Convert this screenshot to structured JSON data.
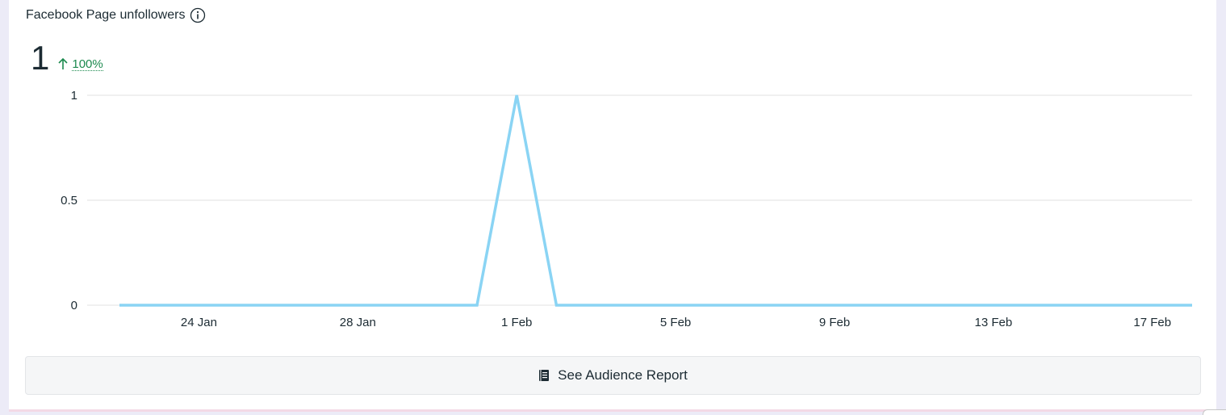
{
  "card": {
    "title": "Facebook Page unfollowers",
    "info_icon": "info-circle-icon",
    "metric_value": "1",
    "delta_icon": "arrow-up-icon",
    "delta_text": "100%",
    "delta_color": "#1d8a4f"
  },
  "chart_data": {
    "type": "line",
    "x": [
      "22 Jan",
      "23 Jan",
      "24 Jan",
      "25 Jan",
      "26 Jan",
      "27 Jan",
      "28 Jan",
      "29 Jan",
      "30 Jan",
      "31 Jan",
      "1 Feb",
      "2 Feb",
      "3 Feb",
      "4 Feb",
      "5 Feb",
      "6 Feb",
      "7 Feb",
      "8 Feb",
      "9 Feb",
      "10 Feb",
      "11 Feb",
      "12 Feb",
      "13 Feb",
      "14 Feb",
      "15 Feb",
      "16 Feb",
      "17 Feb",
      "18 Feb"
    ],
    "series": [
      {
        "values": [
          0,
          0,
          0,
          0,
          0,
          0,
          0,
          0,
          0,
          0,
          1,
          0,
          0,
          0,
          0,
          0,
          0,
          0,
          0,
          0,
          0,
          0,
          0,
          0,
          0,
          0,
          0,
          0
        ],
        "color": "#8ad4f4"
      }
    ],
    "x_tick_labels": [
      "24 Jan",
      "28 Jan",
      "1 Feb",
      "5 Feb",
      "9 Feb",
      "13 Feb",
      "17 Feb"
    ],
    "y_ticks": [
      "0",
      "0.5",
      "1"
    ],
    "ylim": [
      0,
      1
    ],
    "grid": true,
    "gridline_color": "#e0e0e0"
  },
  "footer": {
    "button_label": "See Audience Report",
    "button_icon": "book-icon"
  }
}
